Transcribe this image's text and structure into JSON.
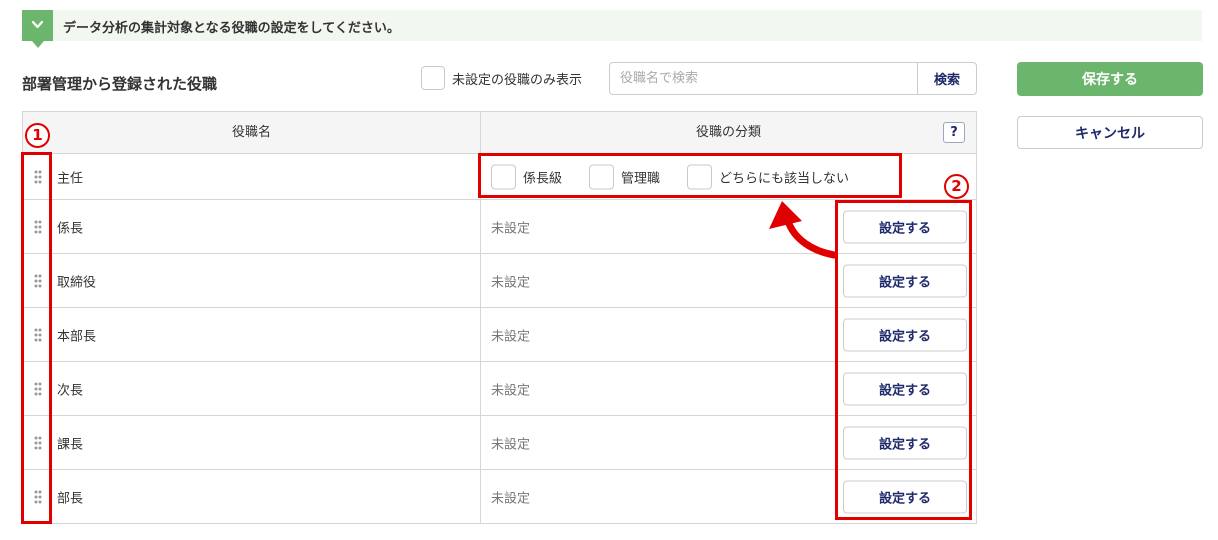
{
  "banner": {
    "text": "データ分析の集計対象となる役職の設定をしてください。"
  },
  "section": {
    "title": "部署管理から登録された役職"
  },
  "filter": {
    "label": "未設定の役職のみ表示"
  },
  "search": {
    "placeholder": "役職名で検索",
    "button_label": "検索"
  },
  "actions": {
    "save_label": "保存する",
    "cancel_label": "キャンセル"
  },
  "table": {
    "columns": {
      "name": "役職名",
      "classification": "役職の分類",
      "help": "?"
    },
    "first_row": {
      "name": "主任",
      "options": [
        "係長級",
        "管理職",
        "どちらにも該当しない"
      ]
    },
    "rows": [
      {
        "name": "係長",
        "status": "未設定",
        "button": "設定する"
      },
      {
        "name": "取締役",
        "status": "未設定",
        "button": "設定する"
      },
      {
        "name": "本部長",
        "status": "未設定",
        "button": "設定する"
      },
      {
        "name": "次長",
        "status": "未設定",
        "button": "設定する"
      },
      {
        "name": "課長",
        "status": "未設定",
        "button": "設定する"
      },
      {
        "name": "部長",
        "status": "未設定",
        "button": "設定する"
      }
    ]
  },
  "annotations": {
    "marker1": "1",
    "marker2": "2",
    "color": "#e00000"
  },
  "colors": {
    "accent": "#6cb56c",
    "button_text": "#1f2a6b",
    "banner_bg": "#f2f8f0"
  }
}
